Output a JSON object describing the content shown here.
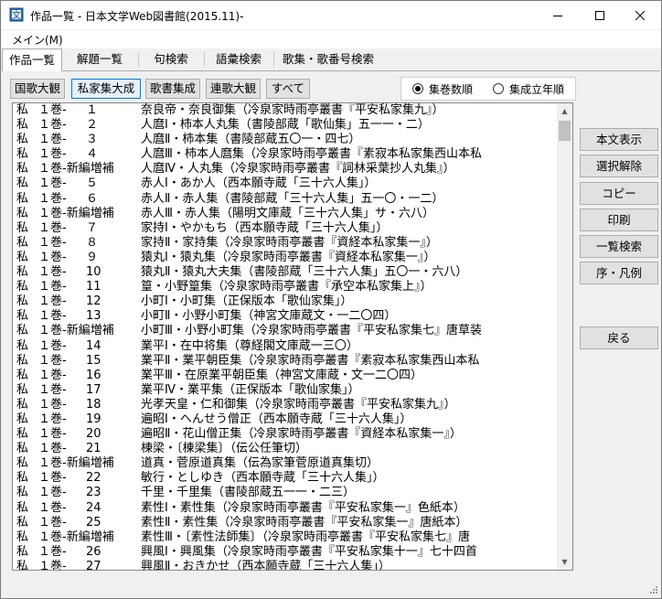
{
  "window": {
    "title": "作品一覧 - 日本文学Web図書館(2015.11)-"
  },
  "menu": {
    "main": "メイン(M)"
  },
  "tabs": [
    {
      "label": "作品一覧"
    },
    {
      "label": "解題一覧"
    },
    {
      "label": "句検索"
    },
    {
      "label": "語彙検索"
    },
    {
      "label": "歌集・歌番号検索"
    }
  ],
  "filters": [
    {
      "label": "国歌大観"
    },
    {
      "label": "私家集大成"
    },
    {
      "label": "歌書集成"
    },
    {
      "label": "連歌大観"
    },
    {
      "label": "すべて"
    }
  ],
  "sort": {
    "options": [
      {
        "label": "集巻数順",
        "selected": true
      },
      {
        "label": "集成立年順",
        "selected": false
      }
    ]
  },
  "actions": {
    "show_text": "本文表示",
    "clear_selection": "選択解除",
    "copy": "コピー",
    "print": "印刷",
    "list_search": "一覧検索",
    "preface_notes": "序・凡例",
    "back": "戻る"
  },
  "rows": [
    {
      "kind": "私",
      "vol": "１巻-",
      "num": "１",
      "title": "奈良帝・奈良御集（冷泉家時雨亭叢書『平安私家集九』）"
    },
    {
      "kind": "私",
      "vol": "１巻-",
      "num": "２",
      "title": "人麿Ⅰ・柿本人丸集（書陵部蔵「歌仙集」五一一・二）"
    },
    {
      "kind": "私",
      "vol": "１巻-",
      "num": "３",
      "title": "人麿Ⅱ・柿本集（書陵部蔵五〇一・四七）"
    },
    {
      "kind": "私",
      "vol": "１巻-",
      "num": "４",
      "title": "人麿Ⅲ・柿本人麿集（冷泉家時雨亭叢書『素寂本私家集西山本私"
    },
    {
      "kind": "私",
      "vol": "１巻-新編増補",
      "num": "",
      "title": "人麿Ⅳ・人丸集（冷泉家時雨亭叢書『詞林采葉抄人丸集』）"
    },
    {
      "kind": "私",
      "vol": "１巻-",
      "num": "５",
      "title": "赤人Ⅰ・あか人（西本願寺蔵「三十六人集」）"
    },
    {
      "kind": "私",
      "vol": "１巻-",
      "num": "６",
      "title": "赤人Ⅱ・赤人集（書陵部蔵「三十六人集」五一〇・一二）"
    },
    {
      "kind": "私",
      "vol": "１巻-新編増補",
      "num": "",
      "title": "赤人Ⅲ・赤人集（陽明文庫蔵「三十六人集」サ・六八）"
    },
    {
      "kind": "私",
      "vol": "１巻-",
      "num": "７",
      "title": "家持Ⅰ・やかもち（西本願寺蔵「三十六人集」）"
    },
    {
      "kind": "私",
      "vol": "１巻-",
      "num": "８",
      "title": "家持Ⅱ・家持集（冷泉家時雨亭叢書『資経本私家集一』）"
    },
    {
      "kind": "私",
      "vol": "１巻-",
      "num": "９",
      "title": "猿丸Ⅰ・猿丸集（冷泉家時雨亭叢書『資経本私家集一』）"
    },
    {
      "kind": "私",
      "vol": "１巻-",
      "num": "10",
      "title": "猿丸Ⅱ・猿丸大夫集（書陵部蔵「三十六人集」五〇一・六八）"
    },
    {
      "kind": "私",
      "vol": "１巻-",
      "num": "11",
      "title": "篁・小野篁集（冷泉家時雨亭叢書『承空本私家集上』）"
    },
    {
      "kind": "私",
      "vol": "１巻-",
      "num": "12",
      "title": "小町Ⅰ・小町集（正保版本「歌仙家集」）"
    },
    {
      "kind": "私",
      "vol": "１巻-",
      "num": "13",
      "title": "小町Ⅱ・小野小町集（神宮文庫蔵文・一二〇四）"
    },
    {
      "kind": "私",
      "vol": "１巻-新編増補",
      "num": "",
      "title": "小町Ⅲ・小野小町集（冷泉家時雨亭叢書『平安私家集七』唐草装"
    },
    {
      "kind": "私",
      "vol": "１巻-",
      "num": "14",
      "title": "業平Ⅰ・在中将集（尊経閣文庫蔵一三〇）"
    },
    {
      "kind": "私",
      "vol": "１巻-",
      "num": "15",
      "title": "業平Ⅱ・業平朝臣集（冷泉家時雨亭叢書『素寂本私家集西山本私"
    },
    {
      "kind": "私",
      "vol": "１巻-",
      "num": "16",
      "title": "業平Ⅲ・在原業平朝臣集（神宮文庫蔵・文一二〇四）"
    },
    {
      "kind": "私",
      "vol": "１巻-",
      "num": "17",
      "title": "業平Ⅳ・業平集（正保版本「歌仙家集」）"
    },
    {
      "kind": "私",
      "vol": "１巻-",
      "num": "18",
      "title": "光孝天皇・仁和御集（冷泉家時雨亭叢書『平安私家集九』）"
    },
    {
      "kind": "私",
      "vol": "１巻-",
      "num": "19",
      "title": "遍昭Ⅰ・へんせう僧正（西本願寺蔵「三十六人集」）"
    },
    {
      "kind": "私",
      "vol": "１巻-",
      "num": "20",
      "title": "遍昭Ⅱ・花山僧正集（冷泉家時雨亭叢書『資経本私家集一』）"
    },
    {
      "kind": "私",
      "vol": "１巻-",
      "num": "21",
      "title": "棟梁・〔棟梁集〕（伝公任筆切）"
    },
    {
      "kind": "私",
      "vol": "１巻-新編増補",
      "num": "",
      "title": "道真・菅原道真集（伝為家筆菅原道真集切）"
    },
    {
      "kind": "私",
      "vol": "１巻-",
      "num": "22",
      "title": "敏行・としゆき（西本願寺蔵「三十六人集」）"
    },
    {
      "kind": "私",
      "vol": "１巻-",
      "num": "23",
      "title": "千里・千里集（書陵部蔵五一一・二三）"
    },
    {
      "kind": "私",
      "vol": "１巻-",
      "num": "24",
      "title": "素性Ⅰ・素性集（冷泉家時雨亭叢書『平安私家集一』色紙本）"
    },
    {
      "kind": "私",
      "vol": "１巻-",
      "num": "25",
      "title": "素性Ⅱ・素性集（冷泉家時雨亭叢書『平安私家集一』唐紙本）"
    },
    {
      "kind": "私",
      "vol": "１巻-新編増補",
      "num": "",
      "title": "素性Ⅲ・〔素性法師集〕（冷泉家時雨亭叢書『平安私家集七』唐"
    },
    {
      "kind": "私",
      "vol": "１巻-",
      "num": "26",
      "title": "興風Ⅰ・興風集（冷泉家時雨亭叢書『平安私家集十一』七十四首"
    },
    {
      "kind": "私",
      "vol": "１巻-",
      "num": "27",
      "title": "興風Ⅱ・おきかせ（西本願寺蔵「三十六人集」）"
    },
    {
      "kind": "私",
      "vol": "１巻-",
      "num": "28 補１",
      "title": "興風Ⅲ・藤原興風集（部類名家集切）"
    },
    {
      "kind": "私",
      "vol": "１巻-",
      "num": "29",
      "title": "躬恒Ⅰ・躬恒集（書陵部蔵五一一・二八）"
    }
  ]
}
